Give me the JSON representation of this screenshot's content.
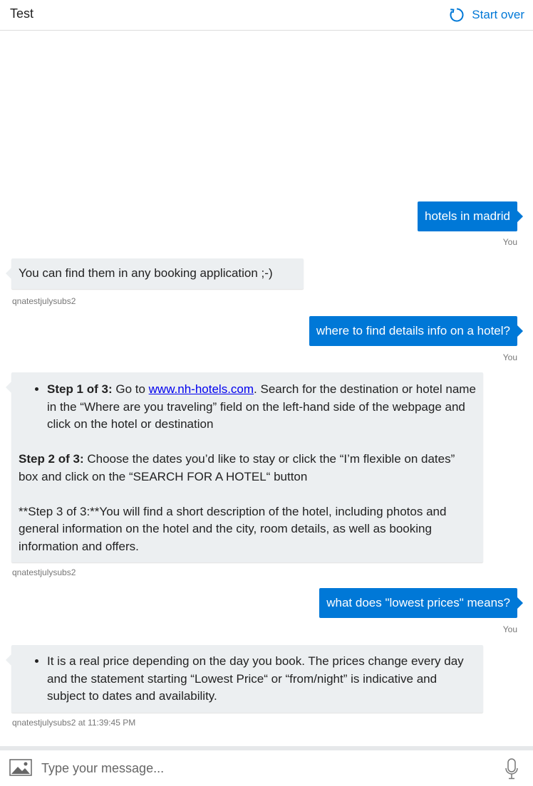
{
  "header": {
    "title": "Test",
    "start_over_label": "Start over"
  },
  "messages": [
    {
      "from": "user",
      "text": "hotels in madrid",
      "meta": "You"
    },
    {
      "from": "bot",
      "text": "You can find them in any booking application ;-)",
      "meta": "qnatestjulysubs2"
    },
    {
      "from": "user",
      "text": "where to find details info on a hotel?",
      "meta": "You"
    },
    {
      "from": "bot",
      "step1_bold": "Step 1 of 3:",
      "step1_pre": " Go to ",
      "step1_link": "www.nh-hotels.com",
      "step1_post": ". Search for the destination or hotel name in the “Where are you traveling” field on the left-hand side of the webpage and click on the hotel or destination",
      "step2_bold": "Step 2 of 3:",
      "step2_text": " Choose the dates you’d like to stay or click the “I’m flexible on dates” box and click on the “SEARCH FOR A HOTEL“ button",
      "step3_text": "**Step 3 of 3:**You will find a short description of the hotel, including photos and general information on the hotel and the city, room details, as well as booking information and offers.",
      "meta": "qnatestjulysubs2"
    },
    {
      "from": "user",
      "text": "what does \"lowest prices\" means?",
      "meta": "You"
    },
    {
      "from": "bot",
      "text": "It is a real price depending on the day you book. The prices change every day and the statement starting “Lowest Price“ or “from/night” is indicative and subject to dates and availability.",
      "meta": "qnatestjulysubs2 at 11:39:45 PM"
    }
  ],
  "composer": {
    "placeholder": "Type your message..."
  },
  "colors": {
    "accent": "#0078d7",
    "bot_bubble": "#eceff1"
  },
  "icons": [
    "refresh-icon",
    "image-upload-icon",
    "microphone-icon"
  ]
}
